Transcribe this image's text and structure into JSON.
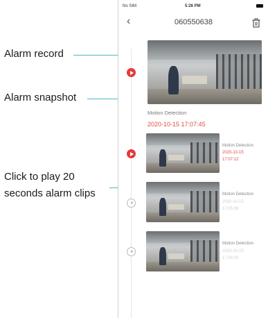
{
  "status_bar": {
    "carrier": "No SIM",
    "time": "5:26 PM"
  },
  "header": {
    "title": "060550638",
    "back_icon": "chevron-left-icon",
    "trash_icon": "trash-icon"
  },
  "annotations": {
    "alarm_record": "Alarm record",
    "alarm_snapshot": "Alarm snapshot",
    "play_clips_line1": "Click to play 20",
    "play_clips_line2": "seconds alarm clips",
    "accent_color": "#4bb6c9"
  },
  "featured": {
    "type": "Motion Detection",
    "datetime": "2020-10-15  17:07:45"
  },
  "records": [
    {
      "type": "Motion Detection",
      "date": "2020-10-15",
      "time": "17:07:12",
      "active": true
    },
    {
      "type": "Motion Detection",
      "date": "2020-10-15",
      "time": "17:05:39",
      "active": false
    },
    {
      "type": "Motion Detection",
      "date": "2020-10-15",
      "time": "17:04:20",
      "active": false
    }
  ],
  "colors": {
    "alarm_red": "#e33b3b"
  }
}
